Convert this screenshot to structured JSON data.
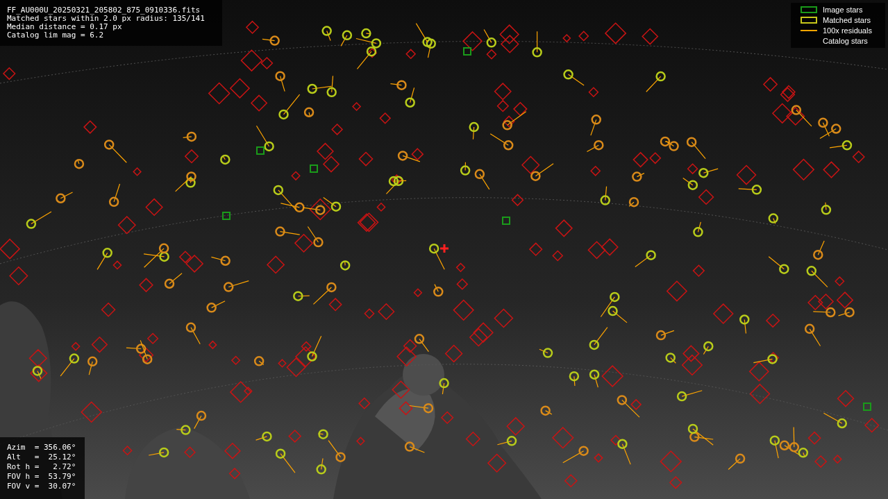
{
  "info": {
    "lines": [
      "FF_AU000U_20250321_205802_875_0910336.fits",
      "Matched stars within 2.0 px radius: 135/141",
      "Median distance = 0.17 px",
      "Catalog lim mag = 6.2"
    ]
  },
  "legend": [
    {
      "label": "Image stars"
    },
    {
      "kind": "matched",
      "label": "Matched stars"
    },
    {
      "kind": "residual",
      "label": "100x residuals"
    },
    {
      "kind": "catalog",
      "label": "Catalog stars"
    }
  ],
  "pointing": {
    "lines": [
      "Azim  = 356.06°",
      "Alt   =  25.12°",
      "Rot h =   2.72°",
      "FOV h =  53.79°",
      "FOV v =  30.07°"
    ]
  }
}
